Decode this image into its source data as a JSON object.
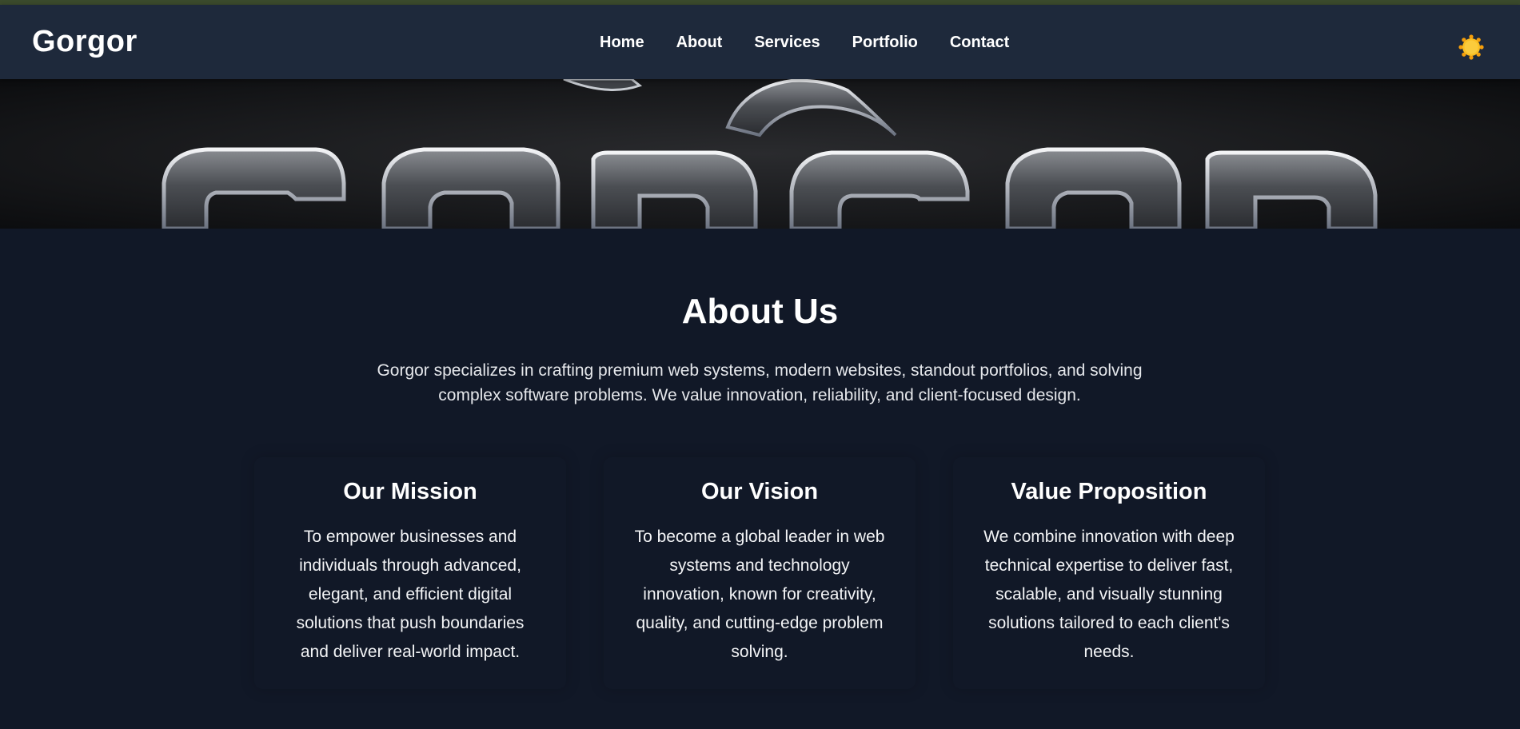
{
  "navbar": {
    "brand": "Gorgor",
    "links": [
      {
        "label": "Home"
      },
      {
        "label": "About"
      },
      {
        "label": "Services"
      },
      {
        "label": "Portfolio"
      },
      {
        "label": "Contact"
      }
    ],
    "theme_icon": "sun-icon"
  },
  "about": {
    "title": "About Us",
    "description": "Gorgor specializes in crafting premium web systems, modern websites, standout portfolios, and solving complex software problems. We value innovation, reliability, and client-focused design.",
    "cards": [
      {
        "title": "Our Mission",
        "text": "To empower businesses and individuals through advanced, elegant, and efficient digital solutions that push boundaries and deliver real-world impact."
      },
      {
        "title": "Our Vision",
        "text": "To become a global leader in web systems and technology innovation, known for creativity, quality, and cutting-edge problem solving."
      },
      {
        "title": "Value Proposition",
        "text": "We combine innovation with deep technical expertise to deliver fast, scalable, and visually stunning solutions tailored to each client's needs."
      }
    ]
  },
  "colors": {
    "navbar_bg": "#1e293b",
    "page_bg": "#111827",
    "text": "#ffffff",
    "sun": "#fbbf24"
  }
}
